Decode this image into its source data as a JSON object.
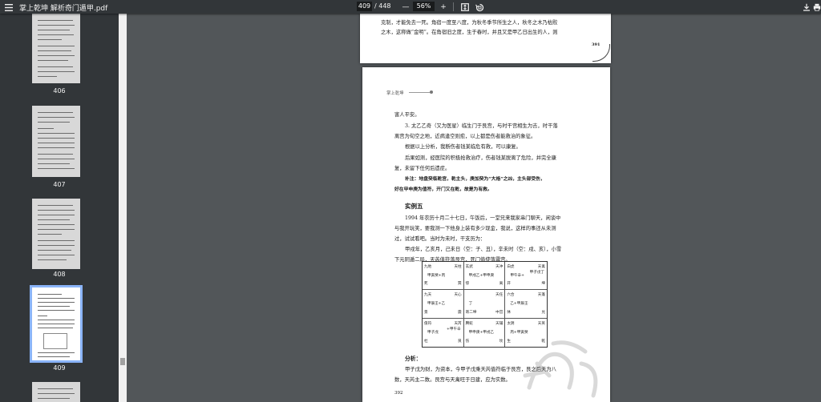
{
  "toolbar": {
    "title": "掌上乾坤 解析奇门遁甲.pdf",
    "page_current": "409",
    "page_total": "/ 448",
    "zoom_out": "—",
    "zoom": "56%",
    "zoom_in": "+"
  },
  "sidebar": {
    "thumbnails": [
      {
        "label": "406"
      },
      {
        "label": "407"
      },
      {
        "label": "408"
      },
      {
        "label": "409",
        "selected": true
      }
    ]
  },
  "page_top": {
    "line1": "克制，才能免去一死。角宿一度至八度，为秋冬季节所生之人，秋冬之木乃枯败",
    "line2": "之木，这称做“金明”。在角宿旧之度，生于春时，并且又是甲乙日出生的人，则",
    "page_number": "391"
  },
  "page_main": {
    "header": "掌上乾坤",
    "lines": [
      "害人平安。",
      "3. 太乙乙奇（又为医星）临生门于艮宫，与时干宫相生为吉，时干落",
      "离宫为旬空之地，近病逢空则愈，以上都是伤者能救治的象征。",
      "根据以上分析，我断伤者钱某临危有救，可以康复。",
      "后果如测，经医院的积极抢救治疗，伤者钱某脱离了危险，并完全康",
      "复，未留下任何后遗症。",
      "补注：地盘癸临乾宫，乾主头，庚加癸为“大格”之凶，主头部受伤，",
      "好在甲申庚为值符，开门又在乾，故是为有救。"
    ],
    "example_title": "实例五",
    "example_lines": [
      "1994 年农历十月二十七日，午饭后，一堂兄来我家串门聊天，闲谈中",
      "与我开玩笑，要我测一下他身上装有多少现金，我说，这样的事还从未测",
      "过，试试看吧。当时为未时，干支历为：",
      "甲戌年，乙亥月，己未日（空：子、丑），辛未时（空：戌、亥），小雪",
      "下元阴遁二局，天芮值符落艮宫，死门值使落震宫。"
    ],
    "chart": [
      {
        "tl": "九地",
        "tr": "天柱",
        "ml": "甲寅癸+丙",
        "bl": "死",
        "br": "巽"
      },
      {
        "tl": "玄武",
        "tr": "天冲",
        "ml": "甲戌乙+甲申庚",
        "bl": "惊",
        "br": "离"
      },
      {
        "tl": "白虎",
        "tr": "天禽",
        "ml": "甲午辛+",
        "mr": "甲子戊丁",
        "bl": "开",
        "br": "坤"
      },
      {
        "tl": "九天",
        "tr": "天心",
        "ml": "甲辰壬+乙",
        "bl": "景",
        "br": "震"
      },
      {
        "tl": "",
        "tr": "天任",
        "ml": "丁",
        "bl": "寄二坤",
        "br": "中宫"
      },
      {
        "tl": "六合",
        "tr": "天蓬",
        "ml": "乙+甲辰壬",
        "bl": "休",
        "br": "兑"
      },
      {
        "tl": "值符",
        "tr": "天芮",
        "ml": "甲子戊",
        "mr": "+甲午辛",
        "bl": "杜",
        "br": "艮"
      },
      {
        "tl": "腾蛇",
        "tr": "天辅",
        "ml": "甲申庚+甲戌乙",
        "bl": "伤",
        "br": "坎"
      },
      {
        "tl": "太阴",
        "tr": "天英",
        "ml": "丙+甲寅癸",
        "bl": "生",
        "br": "乾"
      }
    ],
    "analysis_title": "分析：",
    "analysis_lines": [
      "甲子戊为财，为资本，今甲子戊乘天芮值符临于艮宫，艮之后天为八",
      "数，天芮主二数。艮宫与天禽旺于日建，应为实数。"
    ],
    "page_number": "392"
  },
  "colors": {
    "toolbar_bg": "#323639",
    "viewer_bg": "#525659",
    "selection": "#8ab4f8"
  }
}
